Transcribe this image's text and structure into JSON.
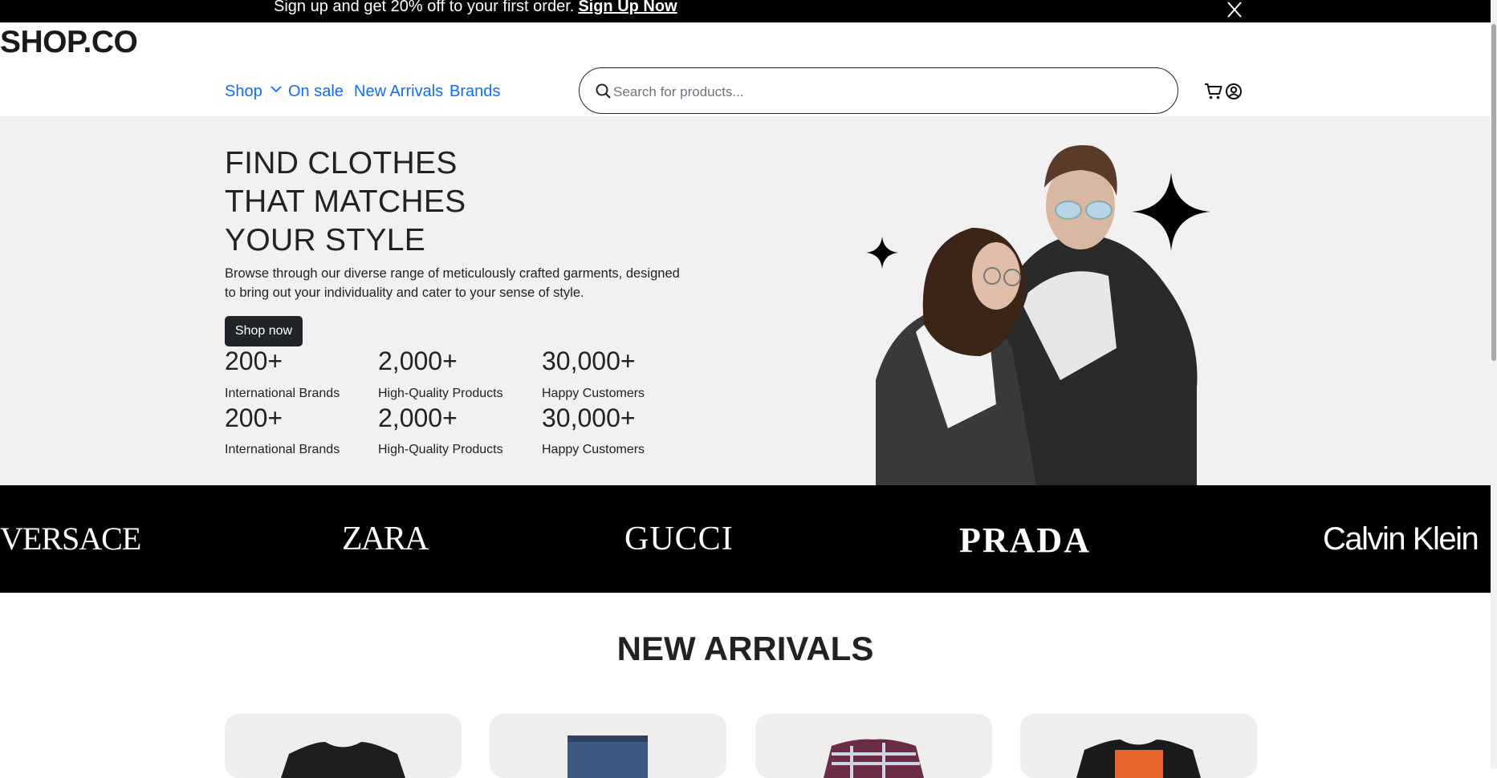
{
  "promo": {
    "text": "Sign up and get 20% off to your first order.",
    "link": "Sign Up Now",
    "close_icon": "close-icon"
  },
  "header": {
    "logo": "SHOP.CO",
    "nav": {
      "shop": "Shop",
      "on_sale": "On sale",
      "new_arrivals": "New Arrivals",
      "brands": "Brands"
    },
    "search": {
      "placeholder": "Search for products...",
      "icon": "search-icon"
    },
    "icons": [
      "cart-icon",
      "user-account-icon"
    ]
  },
  "hero": {
    "title_lines": [
      "FIND CLOTHES",
      "THAT MATCHES",
      "YOUR STYLE"
    ],
    "description": "Browse through our diverse range of meticulously crafted garments, designed to bring out your individuality and cater to your sense of style.",
    "cta": "Shop now",
    "stats": [
      {
        "value": "200+",
        "label": "International Brands"
      },
      {
        "value": "2,000+",
        "label": "High-Quality Products"
      },
      {
        "value": "30,000+",
        "label": "Happy Customers"
      },
      {
        "value": "200+",
        "label": "International Brands"
      },
      {
        "value": "2,000+",
        "label": "High-Quality Products"
      },
      {
        "value": "30,000+",
        "label": "Happy Customers"
      }
    ]
  },
  "brands": [
    "VERSACE",
    "ZARA",
    "GUCCI",
    "PRADA",
    "Calvin Klein"
  ],
  "new_arrivals": {
    "title": "NEW ARRIVALS"
  },
  "colors": {
    "black": "#000000",
    "hero_bg": "#f2f0f1",
    "link_blue": "#0d6efd",
    "card_bg": "#f0eeed"
  }
}
